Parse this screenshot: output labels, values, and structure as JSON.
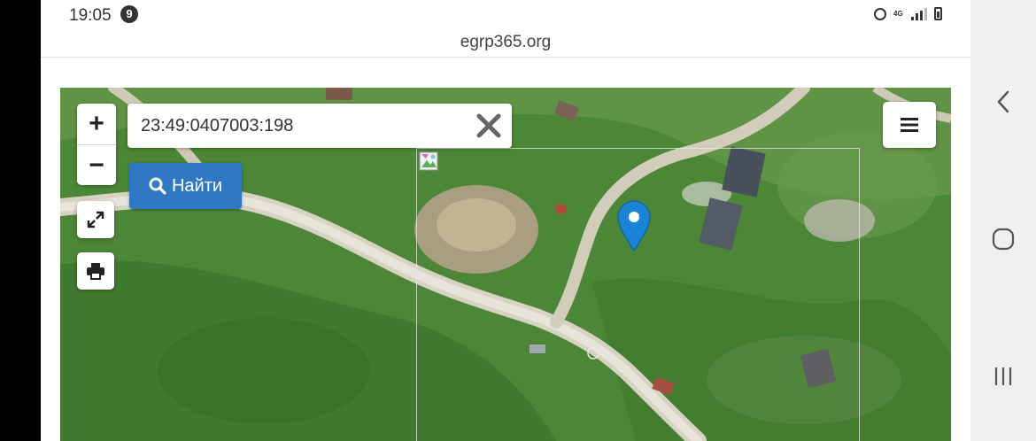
{
  "status_bar": {
    "time": "19:05",
    "notification_count": "9",
    "network_label": "4G"
  },
  "browser": {
    "url": "egrp365.org"
  },
  "map": {
    "search": {
      "value": "23:49:0407003:198"
    },
    "zoom_in_label": "+",
    "zoom_out_label": "−",
    "find_button_label": "Найти",
    "accent_color": "#2f78c4",
    "marker_color": "#1a84d6"
  },
  "icons": {
    "clear": "close-icon",
    "search": "search-icon",
    "fullscreen": "expand-icon",
    "print": "printer-icon",
    "menu": "hamburger-menu-icon",
    "marker": "map-pin-icon",
    "nav_back": "chevron-left-icon",
    "nav_home": "circle-home-icon",
    "nav_recent": "recent-apps-icon"
  }
}
